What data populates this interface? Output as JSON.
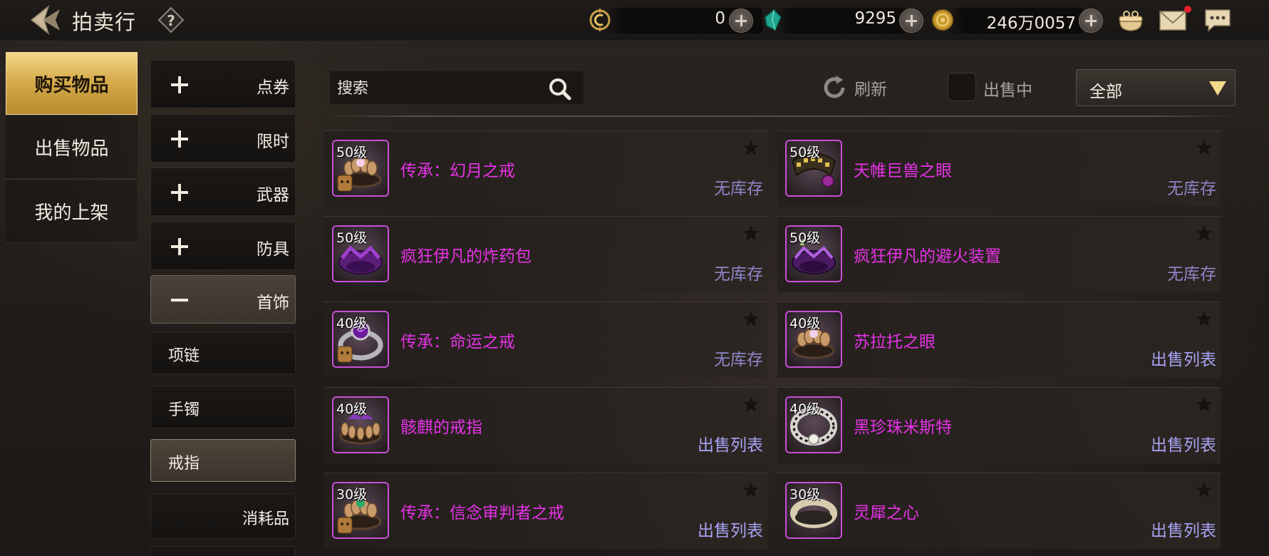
{
  "header": {
    "title": "拍卖行",
    "currencies": [
      {
        "icon": "coupon-icon",
        "value": "0"
      },
      {
        "icon": "gem-icon",
        "value": "9295"
      },
      {
        "icon": "gold-coin-icon",
        "value": "246万0057"
      }
    ]
  },
  "left_menu": [
    {
      "label": "购买物品",
      "active": true
    },
    {
      "label": "出售物品",
      "active": false
    },
    {
      "label": "我的上架",
      "active": false
    }
  ],
  "categories": [
    {
      "label": "点券",
      "sign": "plus"
    },
    {
      "label": "限时",
      "sign": "plus"
    },
    {
      "label": "武器",
      "sign": "plus"
    },
    {
      "label": "防具",
      "sign": "plus"
    },
    {
      "label": "首饰",
      "sign": "minus"
    }
  ],
  "subcategories": [
    {
      "label": "项链"
    },
    {
      "label": "手镯"
    },
    {
      "label": "戒指",
      "active": true
    }
  ],
  "next_category": {
    "label": "消耗品"
  },
  "search": {
    "placeholder": "搜索"
  },
  "refresh_label": "刷新",
  "on_sale_label": "出售中",
  "filter": {
    "selected": "全部"
  },
  "items": {
    "left": [
      {
        "level": "50级",
        "name": "传承：幻月之戒",
        "status": "无库存"
      },
      {
        "level": "50级",
        "name": "疯狂伊凡的炸药包",
        "status": "无库存"
      },
      {
        "level": "40级",
        "name": "传承：命运之戒",
        "status": "无库存"
      },
      {
        "level": "40级",
        "name": "骸麒的戒指",
        "status": "出售列表"
      },
      {
        "level": "30级",
        "name": "传承：信念审判者之戒",
        "status": "出售列表"
      }
    ],
    "right": [
      {
        "level": "50级",
        "name": "天帷巨兽之眼",
        "status": "无库存"
      },
      {
        "level": "50级",
        "name": "疯狂伊凡的避火装置",
        "status": "无库存"
      },
      {
        "level": "40级",
        "name": "苏拉托之眼",
        "status": "出售列表"
      },
      {
        "level": "40级",
        "name": "黑珍珠米斯特",
        "status": "出售列表"
      },
      {
        "level": "30级",
        "name": "灵犀之心",
        "status": "出售列表"
      }
    ]
  },
  "colors": {
    "accent_gold": "#d6ac4c",
    "item_name": "#e632e6",
    "status_none": "#8d86c8",
    "status_list": "#a7a3f4"
  }
}
